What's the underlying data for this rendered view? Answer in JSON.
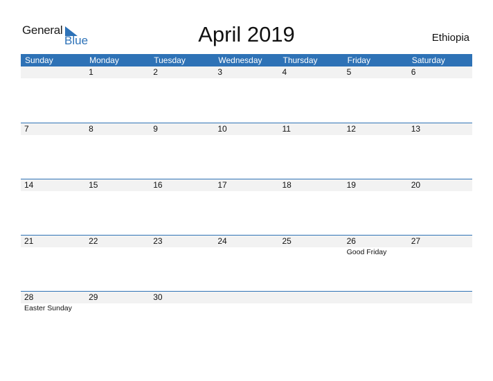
{
  "logo": {
    "word1": "General",
    "word2": "Blue"
  },
  "title": "April 2019",
  "country": "Ethiopia",
  "weekdays": [
    "Sunday",
    "Monday",
    "Tuesday",
    "Wednesday",
    "Thursday",
    "Friday",
    "Saturday"
  ],
  "weeks": [
    {
      "days": [
        "",
        "1",
        "2",
        "3",
        "4",
        "5",
        "6"
      ],
      "events": [
        "",
        "",
        "",
        "",
        "",
        "",
        ""
      ]
    },
    {
      "days": [
        "7",
        "8",
        "9",
        "10",
        "11",
        "12",
        "13"
      ],
      "events": [
        "",
        "",
        "",
        "",
        "",
        "",
        ""
      ]
    },
    {
      "days": [
        "14",
        "15",
        "16",
        "17",
        "18",
        "19",
        "20"
      ],
      "events": [
        "",
        "",
        "",
        "",
        "",
        "",
        ""
      ]
    },
    {
      "days": [
        "21",
        "22",
        "23",
        "24",
        "25",
        "26",
        "27"
      ],
      "events": [
        "",
        "",
        "",
        "",
        "",
        "Good Friday",
        ""
      ]
    },
    {
      "days": [
        "28",
        "29",
        "30",
        "",
        "",
        "",
        ""
      ],
      "events": [
        "Easter Sunday",
        "",
        "",
        "",
        "",
        "",
        ""
      ]
    }
  ],
  "colors": {
    "accent": "#2e72b6",
    "band": "#f2f2f2"
  }
}
